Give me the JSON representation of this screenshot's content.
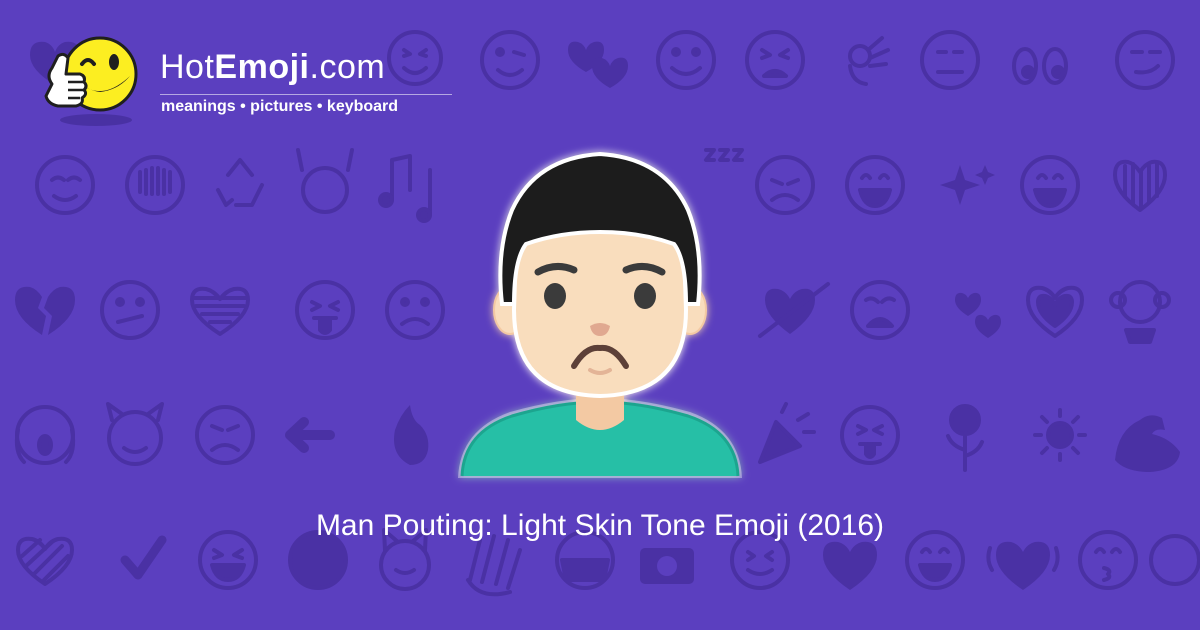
{
  "brand": {
    "name_prefix": "Hot",
    "name_strong": "Emoji",
    "name_suffix": ".com",
    "tagline": "meanings • pictures • keyboard"
  },
  "hero": {
    "emoji_name": "man-pouting-light-skin-tone",
    "caption": "Man Pouting: Light Skin Tone Emoji (2016)"
  },
  "colors": {
    "background": "#5b3fbf",
    "pattern_icons": "#4a31a4",
    "skin": "#f9ddbd",
    "hair": "#1f1f1f",
    "shirt": "#26bfa6",
    "mascot_yellow": "#fcee21"
  },
  "background_icons": [
    "heart-icon",
    "wink-face-icon",
    "heart-icon",
    "smile-face-icon",
    "smile-face-icon",
    "smile-face-icon",
    "kiss-face-icon",
    "two-hearts-icon",
    "smile-face-icon",
    "tired-face-icon",
    "ok-hand-icon",
    "neutral-face-icon",
    "eyes-icon",
    "heart-icon",
    "smirk-face-icon",
    "relieved-face-icon",
    "face-icon",
    "recycle-icon",
    "hands-raised-icon",
    "music-notes-icon",
    "monkey-face-icon",
    "sleeping-face-icon",
    "sad-face-icon",
    "grin-face-icon",
    "sparkles-icon",
    "grin-face-icon",
    "striped-heart-icon",
    "broken-heart-icon",
    "confused-face-icon",
    "striped-heart-icon",
    "tongue-face-icon",
    "frown-face-icon",
    "face-icon",
    "face-icon",
    "heart-arrow-icon",
    "weary-face-icon",
    "revolving-hearts-icon",
    "heart-icon",
    "monkey-icon",
    "scream-face-icon",
    "devil-face-icon",
    "angry-face-icon",
    "left-arrow-icon",
    "fire-icon",
    "party-popper-icon",
    "tongue-face-icon",
    "rose-icon",
    "sun-icon",
    "muscle-icon",
    "striped-heart-icon",
    "check-mark-icon",
    "laugh-face-icon",
    "face-icon",
    "cat-face-icon",
    "waving-hand-icon",
    "mask-face-icon",
    "camera-icon",
    "grin-face-icon",
    "heart-icon",
    "heart-icon",
    "grin-face-icon",
    "kiss-face-icon"
  ]
}
